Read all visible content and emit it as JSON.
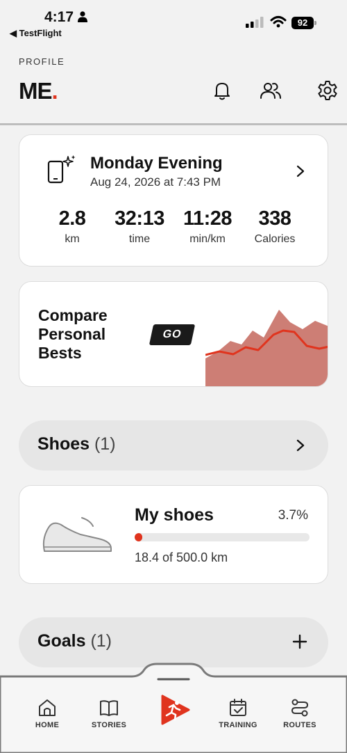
{
  "status_bar": {
    "time": "4:17",
    "back_label": "TestFlight",
    "battery": "92"
  },
  "header": {
    "label": "PROFILE",
    "title": "ME",
    "title_dot": "."
  },
  "activity": {
    "title": "Monday Evening",
    "date": "Aug 24, 2026 at 7:43 PM",
    "stats": [
      {
        "value": "2.8",
        "label": "km"
      },
      {
        "value": "32:13",
        "label": "time"
      },
      {
        "value": "11:28",
        "label": "min/km"
      },
      {
        "value": "338",
        "label": "Calories"
      }
    ]
  },
  "compare": {
    "text": "Compare Personal Bests",
    "go_label": "GO"
  },
  "shoes_section": {
    "title": "Shoes",
    "count": "(1)"
  },
  "shoe": {
    "name": "My shoes",
    "percent": "3.7%",
    "progress": 0.037,
    "distance": "18.4 of 500.0 km"
  },
  "goals_section": {
    "title": "Goals",
    "count": "(1)"
  },
  "tabs": [
    {
      "label": "HOME",
      "icon": "home-icon"
    },
    {
      "label": "STORIES",
      "icon": "book-icon"
    },
    {
      "label": "",
      "icon": "run-icon"
    },
    {
      "label": "TRAINING",
      "icon": "calendar-check-icon"
    },
    {
      "label": "ROUTES",
      "icon": "route-icon"
    }
  ],
  "colors": {
    "accent": "#e0341e",
    "background": "#f2f2f2",
    "chart_fill": "#cd7e75"
  }
}
